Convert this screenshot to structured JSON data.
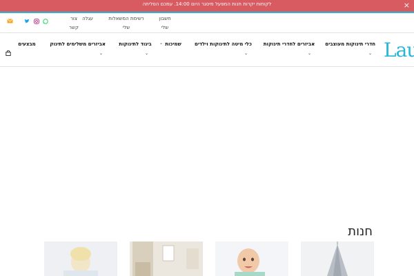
{
  "announcement": {
    "text": "לקוחות יקרות חנות המפעל מיסגר היום 14:00. עמכם הסליחה",
    "close_glyph": "×"
  },
  "utility_links": [
    {
      "label": "חשבון שלי"
    },
    {
      "label": "רשימת המשאלות שלי"
    },
    {
      "label": "עגלה"
    },
    {
      "label": "צור קשר"
    }
  ],
  "social_icons": [
    "whatsapp-icon",
    "instagram-icon",
    "twitter-icon",
    "mail-icon"
  ],
  "logo": {
    "text": "Lau"
  },
  "nav": {
    "items": [
      {
        "label": "חדרי תינוקות מעוצבים"
      },
      {
        "label": "אביזרים לחדרי תינוקות"
      },
      {
        "label": "כלי מיטה לתינוקות וילדים"
      },
      {
        "label": "שמיכות"
      },
      {
        "label": "ביגוד לתינוקות"
      },
      {
        "label": "אביזרים משלימים לתינוק"
      },
      {
        "label": "מבצעים"
      }
    ],
    "chevron": "⌄"
  },
  "shop": {
    "title": "חנות",
    "thumbnails": [
      "toddler-photo",
      "nursery-room-photo",
      "baby-photo",
      "canopy-photo"
    ]
  },
  "colors": {
    "announcement_bg": "#d85b61",
    "accent": "#25b8d6"
  }
}
